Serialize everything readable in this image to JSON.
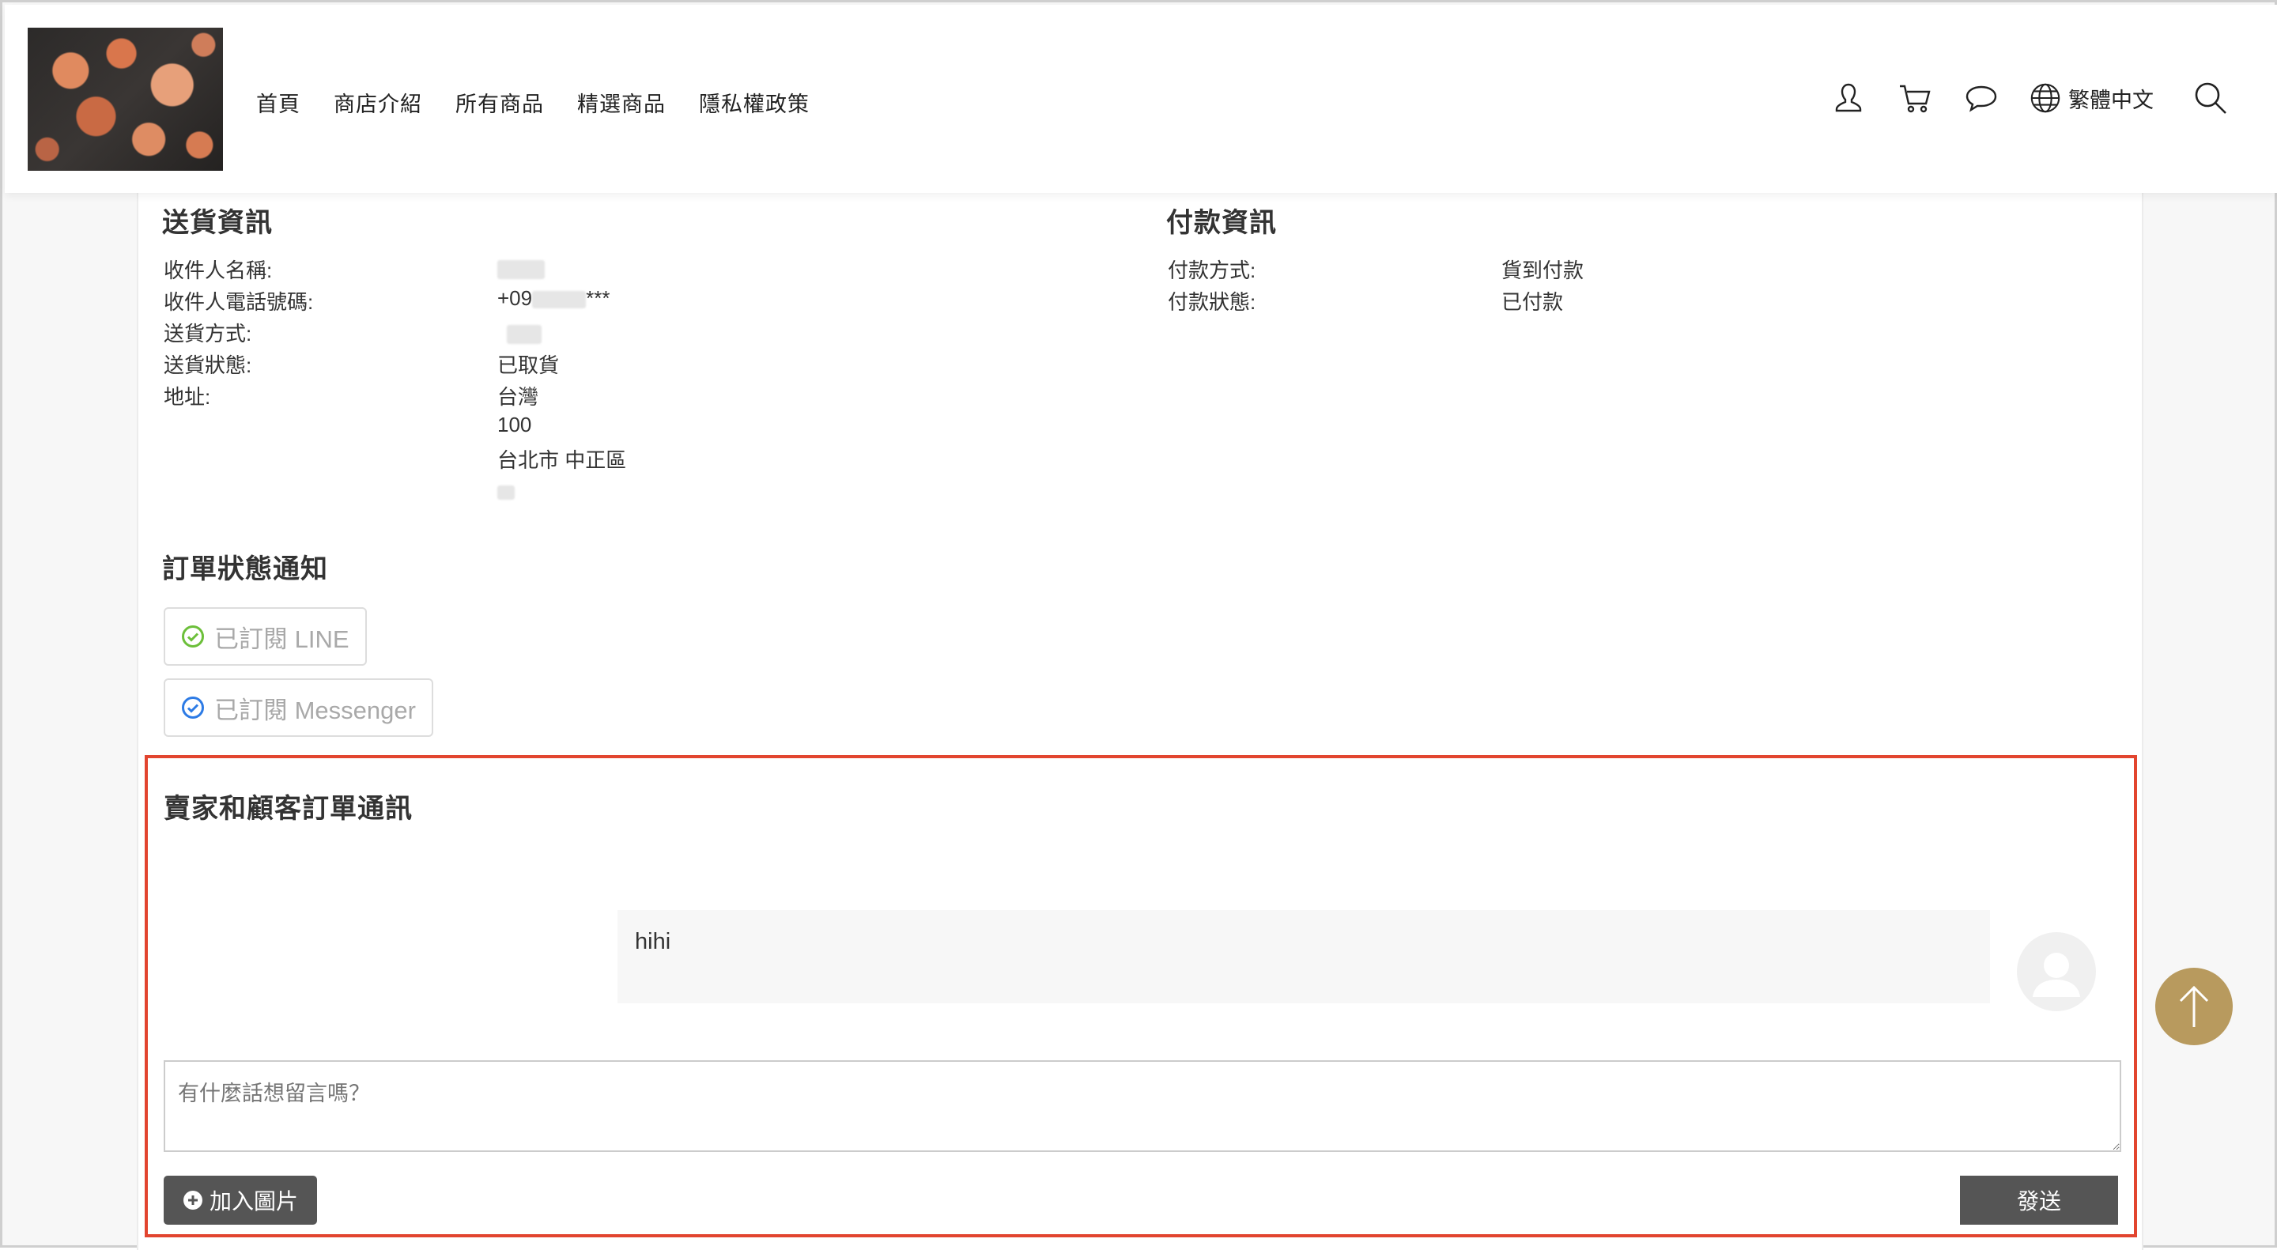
{
  "header": {
    "nav": [
      "首頁",
      "商店介紹",
      "所有商品",
      "精選商品",
      "隱私權政策"
    ],
    "language": "繁體中文",
    "icons": [
      "user-icon",
      "cart-icon",
      "chat-bubble-icon",
      "globe-icon",
      "search-icon"
    ]
  },
  "shipping": {
    "title": "送貨資訊",
    "labels": {
      "recipient_name": "收件人名稱:",
      "recipient_phone": "收件人電話號碼:",
      "method": "送貨方式:",
      "status": "送貨狀態:",
      "address": "地址:"
    },
    "values": {
      "phone_prefix": "+09",
      "phone_suffix": "***",
      "status": "已取貨",
      "address_country": "台灣",
      "address_zip": "100",
      "address_city": "台北市 中正區"
    }
  },
  "payment": {
    "title": "付款資訊",
    "labels": {
      "method": "付款方式:",
      "status": "付款狀態:"
    },
    "values": {
      "method": "貨到付款",
      "status": "已付款"
    }
  },
  "notifications": {
    "title": "訂單狀態通知",
    "line_label": "已訂閱 LINE",
    "messenger_label": "已訂閱 Messenger",
    "line_color": "#6cbf3a",
    "messenger_color": "#2d7be5"
  },
  "chat": {
    "title": "賣家和顧客訂單通訊",
    "messages": [
      {
        "text": "hihi"
      }
    ],
    "input_placeholder": "有什麼話想留言嗎？",
    "add_image_label": "加入圖片",
    "send_label": "發送",
    "highlight_color": "#e2452f"
  },
  "scroll_top_color": "#b89a5e"
}
